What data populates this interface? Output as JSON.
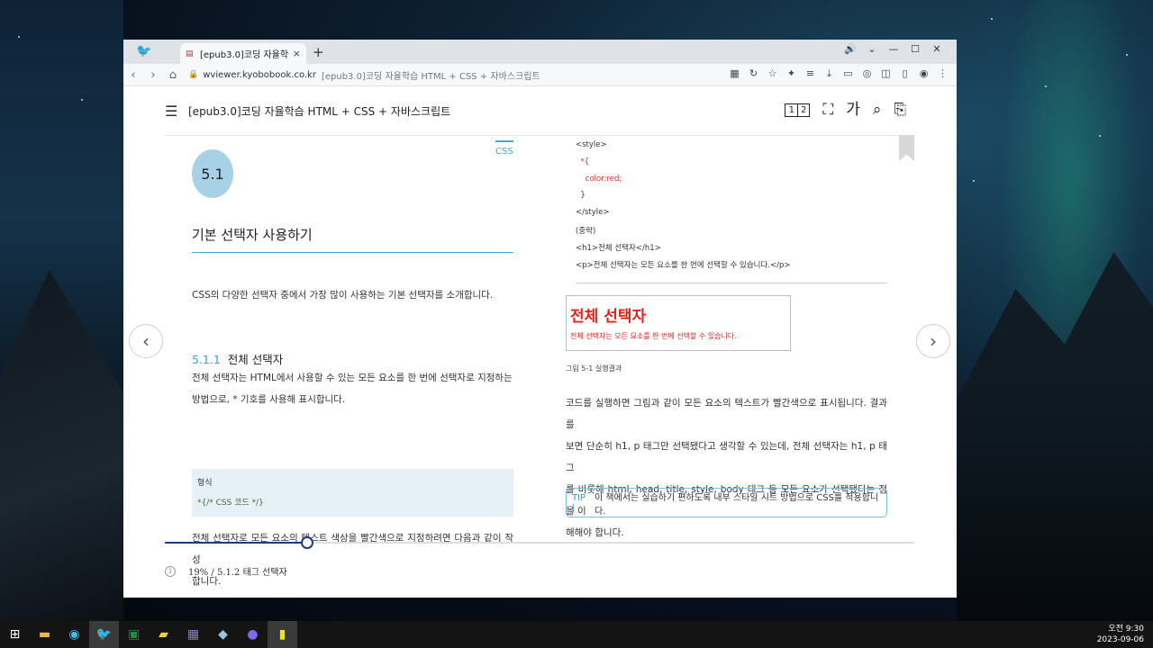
{
  "browser": {
    "tab_title": "[epub3.0]코딩 자율학습 HTML + CSS + 자바스크립트",
    "tab_close": "×",
    "new_tab": "+",
    "url_host": "wviewer.kyobobook.co.kr",
    "url_page_title": "[epub3.0]코딩 자율학습 HTML + CSS + 자바스크립트"
  },
  "viewer": {
    "book_title": "[epub3.0]코딩 자율학습 HTML + CSS + 자바스크립트",
    "page_toggle": [
      "1",
      "2"
    ],
    "font_label": "가"
  },
  "left_page": {
    "chapter_number": "5.1",
    "category_tag": "CSS",
    "section_title": "기본 선택자 사용하기",
    "intro": "CSS의 다양한 선택자 중에서 가장 많이 사용하는 기본 선택자를 소개합니다.",
    "subsection_number": "5.1.1",
    "subsection_title": "전체 선택자",
    "paragraph1_line1": "전체 선택자는 HTML에서 사용할 수 있는 모든 요소를 한 번에 선택자로 지정하는",
    "paragraph1_line2": "방법으로, * 기호를 사용해 표시합니다.",
    "form_label": "형식",
    "form_code": "*{/* CSS 코드 */}",
    "paragraph2_line1": "전체 선택자로 모든 요소의 텍스트 색상을 빨간색으로 지정하려면 다음과 같이 작성",
    "paragraph2_line2": "합니다."
  },
  "right_page": {
    "code_lines": [
      "<style>",
      "  *{",
      "    color:red;",
      "  }",
      "</style>",
      "(중략)",
      "<h1>전체 선택자</h1>",
      "<p>전체 선택자는 모든 요소를 한 번에 선택할 수 있습니다.</p>"
    ],
    "result_heading": "전체 선택자",
    "result_paragraph": "전체 선택자는 모든 요소를 한 번에 선택할 수 있습니다.",
    "figure_caption": "그림 5-1 실행결과",
    "body_lines": [
      "코드를 실행하면 그림과 같이 모든 요소의 텍스트가 빨간색으로 표시됩니다. 결과를",
      "보면 단순히 h1, p 태그만 선택됐다고 생각할 수 있는데, 전체 선택자는 h1, p 태그",
      "를 비롯해 html, head, title, style, body 태그 등 모든 요소가 선택됐다는 점을 이",
      "해해야 합니다."
    ],
    "tip_label": "TIP |",
    "tip_text": "이 책에서는 실습하기 편하도록 내부 스타일 시트 방법으로 CSS를 적용합니다."
  },
  "progress": {
    "fraction": 0.19,
    "label": "19% / 5.1.2 태그 선택자"
  },
  "taskbar": {
    "time": "오전 9:30",
    "date": "2023-09-06"
  },
  "colors": {
    "accent_blue": "#3f9ccd",
    "progress_navy": "#1e3a8a",
    "result_red": "#e0231b"
  }
}
